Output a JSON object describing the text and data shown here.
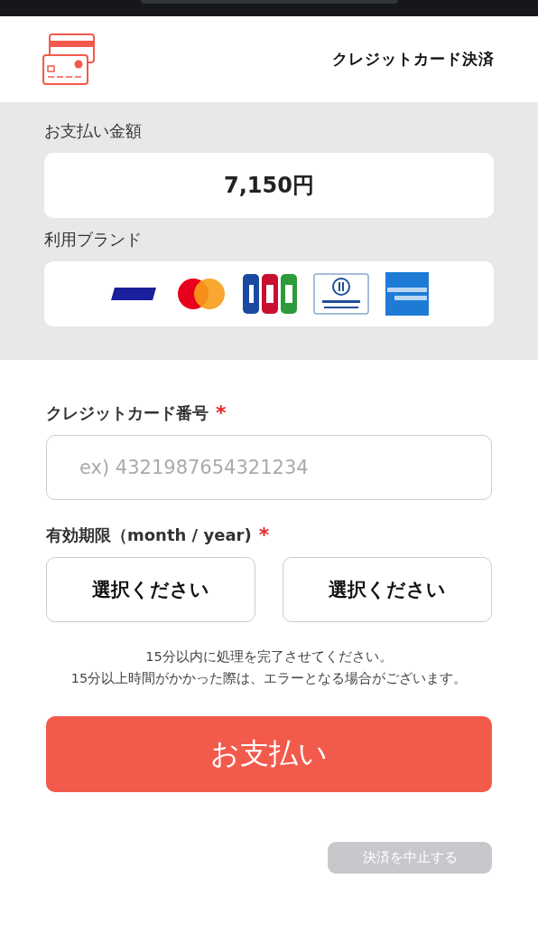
{
  "header": {
    "title": "クレジットカード決済"
  },
  "amount": {
    "label": "お支払い金額",
    "value": "7,150円"
  },
  "brands": {
    "label": "利用ブランド",
    "items": [
      {
        "kind": "visa"
      },
      {
        "kind": "mastercard"
      },
      {
        "kind": "jcb"
      },
      {
        "kind": "diners"
      },
      {
        "kind": "amex"
      }
    ]
  },
  "card_number": {
    "label": "クレジットカード番号",
    "required_mark": "*",
    "placeholder": "ex) 4321987654321234"
  },
  "expiry": {
    "label": "有効期限（month / year)",
    "required_mark": "*",
    "selects": [
      {
        "value": "選択ください"
      },
      {
        "value": "選択ください"
      }
    ]
  },
  "notice": [
    "15分以内に処理を完了させてください。",
    "15分以上時間がかかった際は、エラーとなる場合がございます。"
  ],
  "pay_button": "お支払い",
  "cancel_button": "決済を中止する"
}
